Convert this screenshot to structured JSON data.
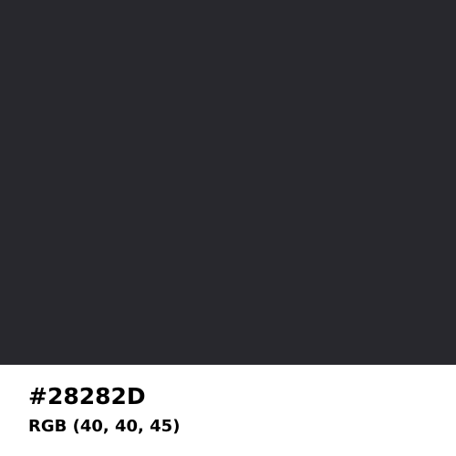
{
  "swatch": {
    "color": "#28282D"
  },
  "labels": {
    "hex": "#28282D",
    "rgb": "RGB (40, 40, 45)"
  }
}
